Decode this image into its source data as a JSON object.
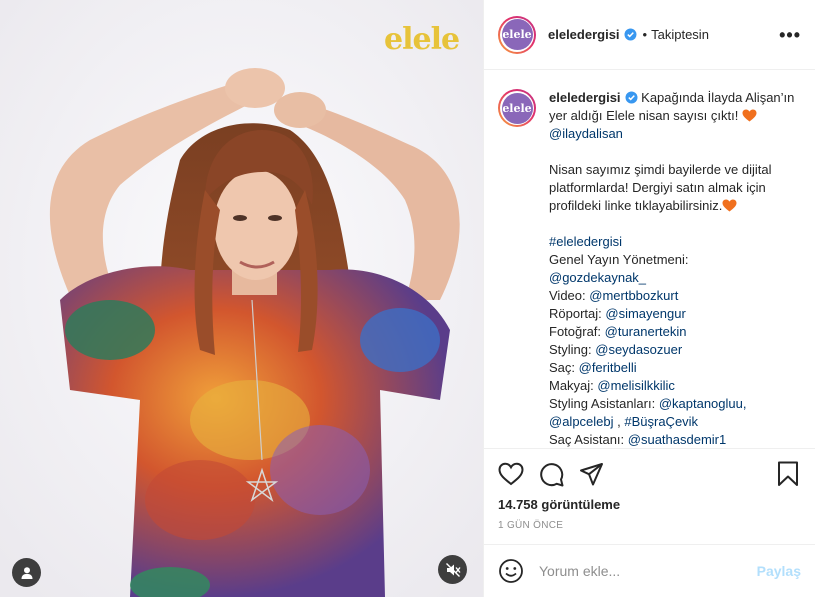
{
  "media": {
    "logo_text": "elele"
  },
  "header": {
    "avatar_text": "elele",
    "username": "eleledergisi",
    "dot": "•",
    "follow_status": "Takiptesin",
    "more_label": "•••"
  },
  "caption": {
    "avatar_text": "elele",
    "username": "eleledergisi",
    "intro_a": " Kapağında İlayda Alişan’ın yer aldığı Elele nisan sayısı çıktı! ",
    "mention_main": "@ilaydalisan",
    "para2": "Nisan sayımız şimdi bayilerde ve dijital platformlarda! Dergiyi satın almak için profildeki linke tıklayabilirsiniz.",
    "hashtag": "#eleledergisi",
    "gyy_label": "Genel Yayın Yönetmeni:",
    "gyy_handle": "@gozdekaynak_",
    "video_label": "Video: ",
    "video_handle": "@mertbbozkurt",
    "roportaj_label": "Röportaj: ",
    "roportaj_handle": "@simayengur",
    "foto_label": "Fotoğraf: ",
    "foto_handle": "@turanertekin",
    "styling_label": "Styling: ",
    "styling_handle": "@seydasozuer",
    "sac_label": "Saç: ",
    "sac_handle": "@feritbelli",
    "makyaj_label": "Makyaj: ",
    "makyaj_handle": "@melisilkkilic",
    "asist_label": "Styling Asistanları: ",
    "asist_h1": "@kaptanogluu,",
    "asist_h2": "@alpcelebj",
    "asist_sep": " , ",
    "asist_h3": "#BüşraÇevik",
    "sacasist_label": "Saç Asistanı: ",
    "sacasist_handle": "@suathasdemir1"
  },
  "actions": {
    "views": "14.758 görüntüleme",
    "time": "1 GÜN ÖNCE"
  },
  "comment": {
    "placeholder": "Yorum ekle...",
    "post_label": "Paylaş"
  },
  "icons": {
    "like": "heart-outline-icon",
    "comment": "speech-bubble-icon",
    "share": "paper-plane-icon",
    "save": "bookmark-icon",
    "emoji": "smiley-icon",
    "tag": "user-tag-icon",
    "mute": "speaker-muted-icon",
    "verified": "verified-badge-icon",
    "heart_emoji": "orange-heart-emoji"
  },
  "colors": {
    "link": "#00376b",
    "verified": "#3897f0",
    "post_disabled": "#b2dffc",
    "logo": "#e7c33a",
    "heart_emoji": "#f0701e"
  }
}
